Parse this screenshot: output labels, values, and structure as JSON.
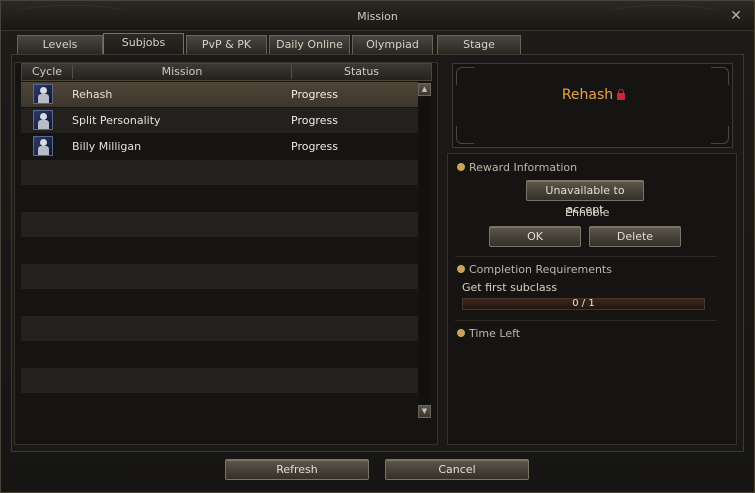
{
  "window": {
    "title": "Mission"
  },
  "tabs": [
    {
      "label": "Levels"
    },
    {
      "label": "Subjobs",
      "active": true
    },
    {
      "label": "PvP & PK"
    },
    {
      "label": "Daily Online"
    },
    {
      "label": "Olympiad"
    },
    {
      "label": "Stage"
    }
  ],
  "list": {
    "columns": {
      "cycle": "Cycle",
      "mission": "Mission",
      "status": "Status"
    },
    "rows": [
      {
        "name": "Rehash",
        "status": "Progress",
        "icon": "class-portrait-icon",
        "selected": true
      },
      {
        "name": "Split Personality",
        "status": "Progress",
        "icon": "class-portrait-icon"
      },
      {
        "name": "Billy Milligan",
        "status": "Progress",
        "icon": "class-portrait-icon"
      }
    ]
  },
  "detail": {
    "title": "Rehash",
    "title_icon": "lock-icon",
    "reward_label": "Reward Information",
    "unavailable_button": "Unavailable to accept",
    "reward_text": "Ennoble",
    "ok_button": "OK",
    "delete_button": "Delete",
    "completion_label": "Completion Requirements",
    "requirement_text": "Get first subclass",
    "progress_text": "0 / 1",
    "progress_value": 0,
    "time_label": "Time Left"
  },
  "footer": {
    "refresh_button": "Refresh",
    "cancel_button": "Cancel"
  },
  "colors": {
    "accent_title": "#e9a34a",
    "lock": "#c8283a",
    "selected_row": "#4e4537"
  }
}
